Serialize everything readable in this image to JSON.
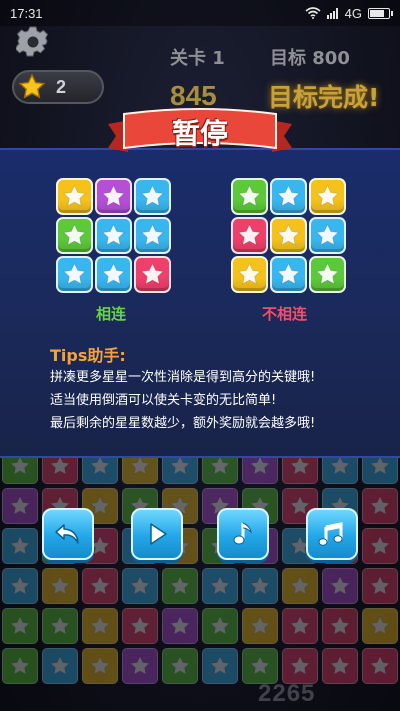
{
  "status_bar": {
    "time": "17:31",
    "network": "4G",
    "battery_level": 0.85
  },
  "hud": {
    "level_label": "关卡 1",
    "target_label": "目标 800",
    "score": "845",
    "star_count": "2",
    "goal_complete_text": "目标完成!"
  },
  "pause_dialog": {
    "title": "暂停",
    "connected_label": "相连",
    "not_connected_label": "不相连",
    "left_grid_colors": [
      "yellow",
      "purple",
      "blue",
      "green",
      "blue",
      "blue",
      "blue",
      "blue",
      "pink"
    ],
    "right_grid_colors": [
      "green",
      "blue",
      "yellow",
      "pink",
      "yellow",
      "blue",
      "yellow",
      "blue",
      "green"
    ],
    "tips_title": "Tips助手:",
    "tips": [
      "拼凑更多星星一次性消除是得到高分的关键哦!",
      "适当使用倒酒可以使关卡变的无比简单!",
      "最后剩余的星星数越少，额外奖励就会越多哦!"
    ]
  },
  "controls": [
    {
      "name": "back-button",
      "icon": "undo-arrow-icon"
    },
    {
      "name": "resume-button",
      "icon": "play-icon"
    },
    {
      "name": "sound-button",
      "icon": "music-note-icon"
    },
    {
      "name": "music-button",
      "icon": "double-music-note-icon"
    }
  ],
  "colors": {
    "yellow": "#f5c21b",
    "purple": "#b64fd8",
    "blue": "#38b6ef",
    "green": "#5cc93a",
    "pink": "#ef3f6b",
    "ribbon": "#e8473a",
    "panel": "#1b2a5c"
  },
  "board_rows": [
    [
      "green",
      "pink",
      "blue",
      "yellow",
      "blue",
      "green",
      "purple",
      "pink",
      "blue",
      "blue"
    ],
    [
      "purple",
      "pink",
      "yellow",
      "green",
      "yellow",
      "purple",
      "green",
      "pink",
      "blue",
      "pink"
    ],
    [
      "blue",
      "green",
      "pink",
      "blue",
      "yellow",
      "green",
      "purple",
      "blue",
      "pink",
      "pink"
    ],
    [
      "blue",
      "yellow",
      "pink",
      "blue",
      "green",
      "blue",
      "blue",
      "yellow",
      "purple",
      "pink"
    ],
    [
      "green",
      "green",
      "yellow",
      "pink",
      "purple",
      "green",
      "yellow",
      "pink",
      "pink",
      "yellow"
    ],
    [
      "green",
      "blue",
      "yellow",
      "purple",
      "green",
      "blue",
      "green",
      "pink",
      "pink",
      "pink"
    ]
  ],
  "watermark": "2265"
}
